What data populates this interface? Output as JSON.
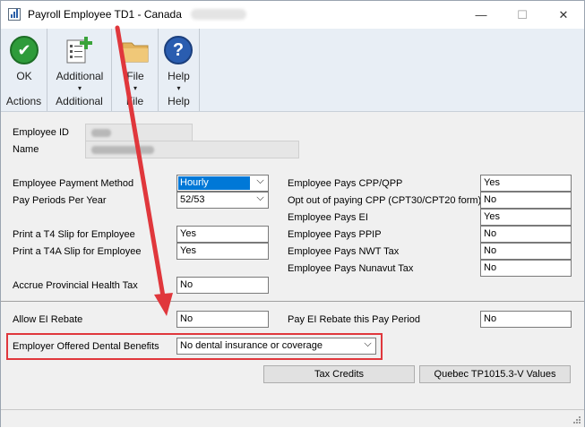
{
  "window": {
    "title": "Payroll Employee TD1 - Canada",
    "controls": {
      "minimize": "—",
      "maximize": "☐",
      "close": "✕"
    }
  },
  "ribbon": {
    "groups": [
      {
        "button_label": "OK",
        "group_label": "Actions",
        "icon": "ok-check-icon",
        "has_arrow": false
      },
      {
        "button_label": "Additional",
        "group_label": "Additional",
        "icon": "additional-document-icon",
        "has_arrow": true
      },
      {
        "button_label": "File",
        "group_label": "File",
        "icon": "file-folder-icon",
        "has_arrow": true
      },
      {
        "button_label": "Help",
        "group_label": "Help",
        "icon": "help-question-icon",
        "has_arrow": true
      }
    ],
    "ok_glyph": "✔",
    "help_glyph": "?",
    "arrow_glyph": "▾"
  },
  "employee": {
    "id_label": "Employee ID",
    "name_label": "Name"
  },
  "left_fields": {
    "payment_method": {
      "label": "Employee Payment Method",
      "value": "Hourly"
    },
    "pay_periods": {
      "label": "Pay Periods Per Year",
      "value": "52/53"
    },
    "t4_slip": {
      "label": "Print a T4 Slip for Employee",
      "value": "Yes"
    },
    "t4a_slip": {
      "label": "Print a T4A Slip for Employee",
      "value": "Yes"
    },
    "provincial_health": {
      "label": "Accrue Provincial Health Tax",
      "value": "No"
    },
    "ei_rebate": {
      "label": "Allow EI Rebate",
      "value": "No"
    },
    "dental": {
      "label": "Employer Offered Dental Benefits",
      "value": "No dental insurance or coverage"
    }
  },
  "right_fields": {
    "cpp_qpp": {
      "label": "Employee Pays CPP/QPP",
      "value": "Yes"
    },
    "opt_out_cpp": {
      "label": "Opt out of paying CPP (CPT30/CPT20 form)",
      "value": "No"
    },
    "ei": {
      "label": "Employee Pays EI",
      "value": "Yes"
    },
    "ppip": {
      "label": "Employee Pays PPIP",
      "value": "No"
    },
    "nwt_tax": {
      "label": "Employee Pays NWT Tax",
      "value": "No"
    },
    "nunavut_tax": {
      "label": "Employee Pays Nunavut Tax",
      "value": "No"
    },
    "pay_ei_rebate": {
      "label": "Pay EI Rebate this Pay Period",
      "value": "No"
    }
  },
  "buttons": {
    "tax_credits": "Tax Credits",
    "quebec": "Quebec TP1015.3-V Values"
  },
  "combo_arrow": "⌵",
  "colors": {
    "annotation_red": "#e0373c",
    "selection_blue": "#0078d7",
    "ribbon_bg": "#e8eef5",
    "ok_green": "#2e9b3a",
    "help_blue": "#2a5db0"
  }
}
